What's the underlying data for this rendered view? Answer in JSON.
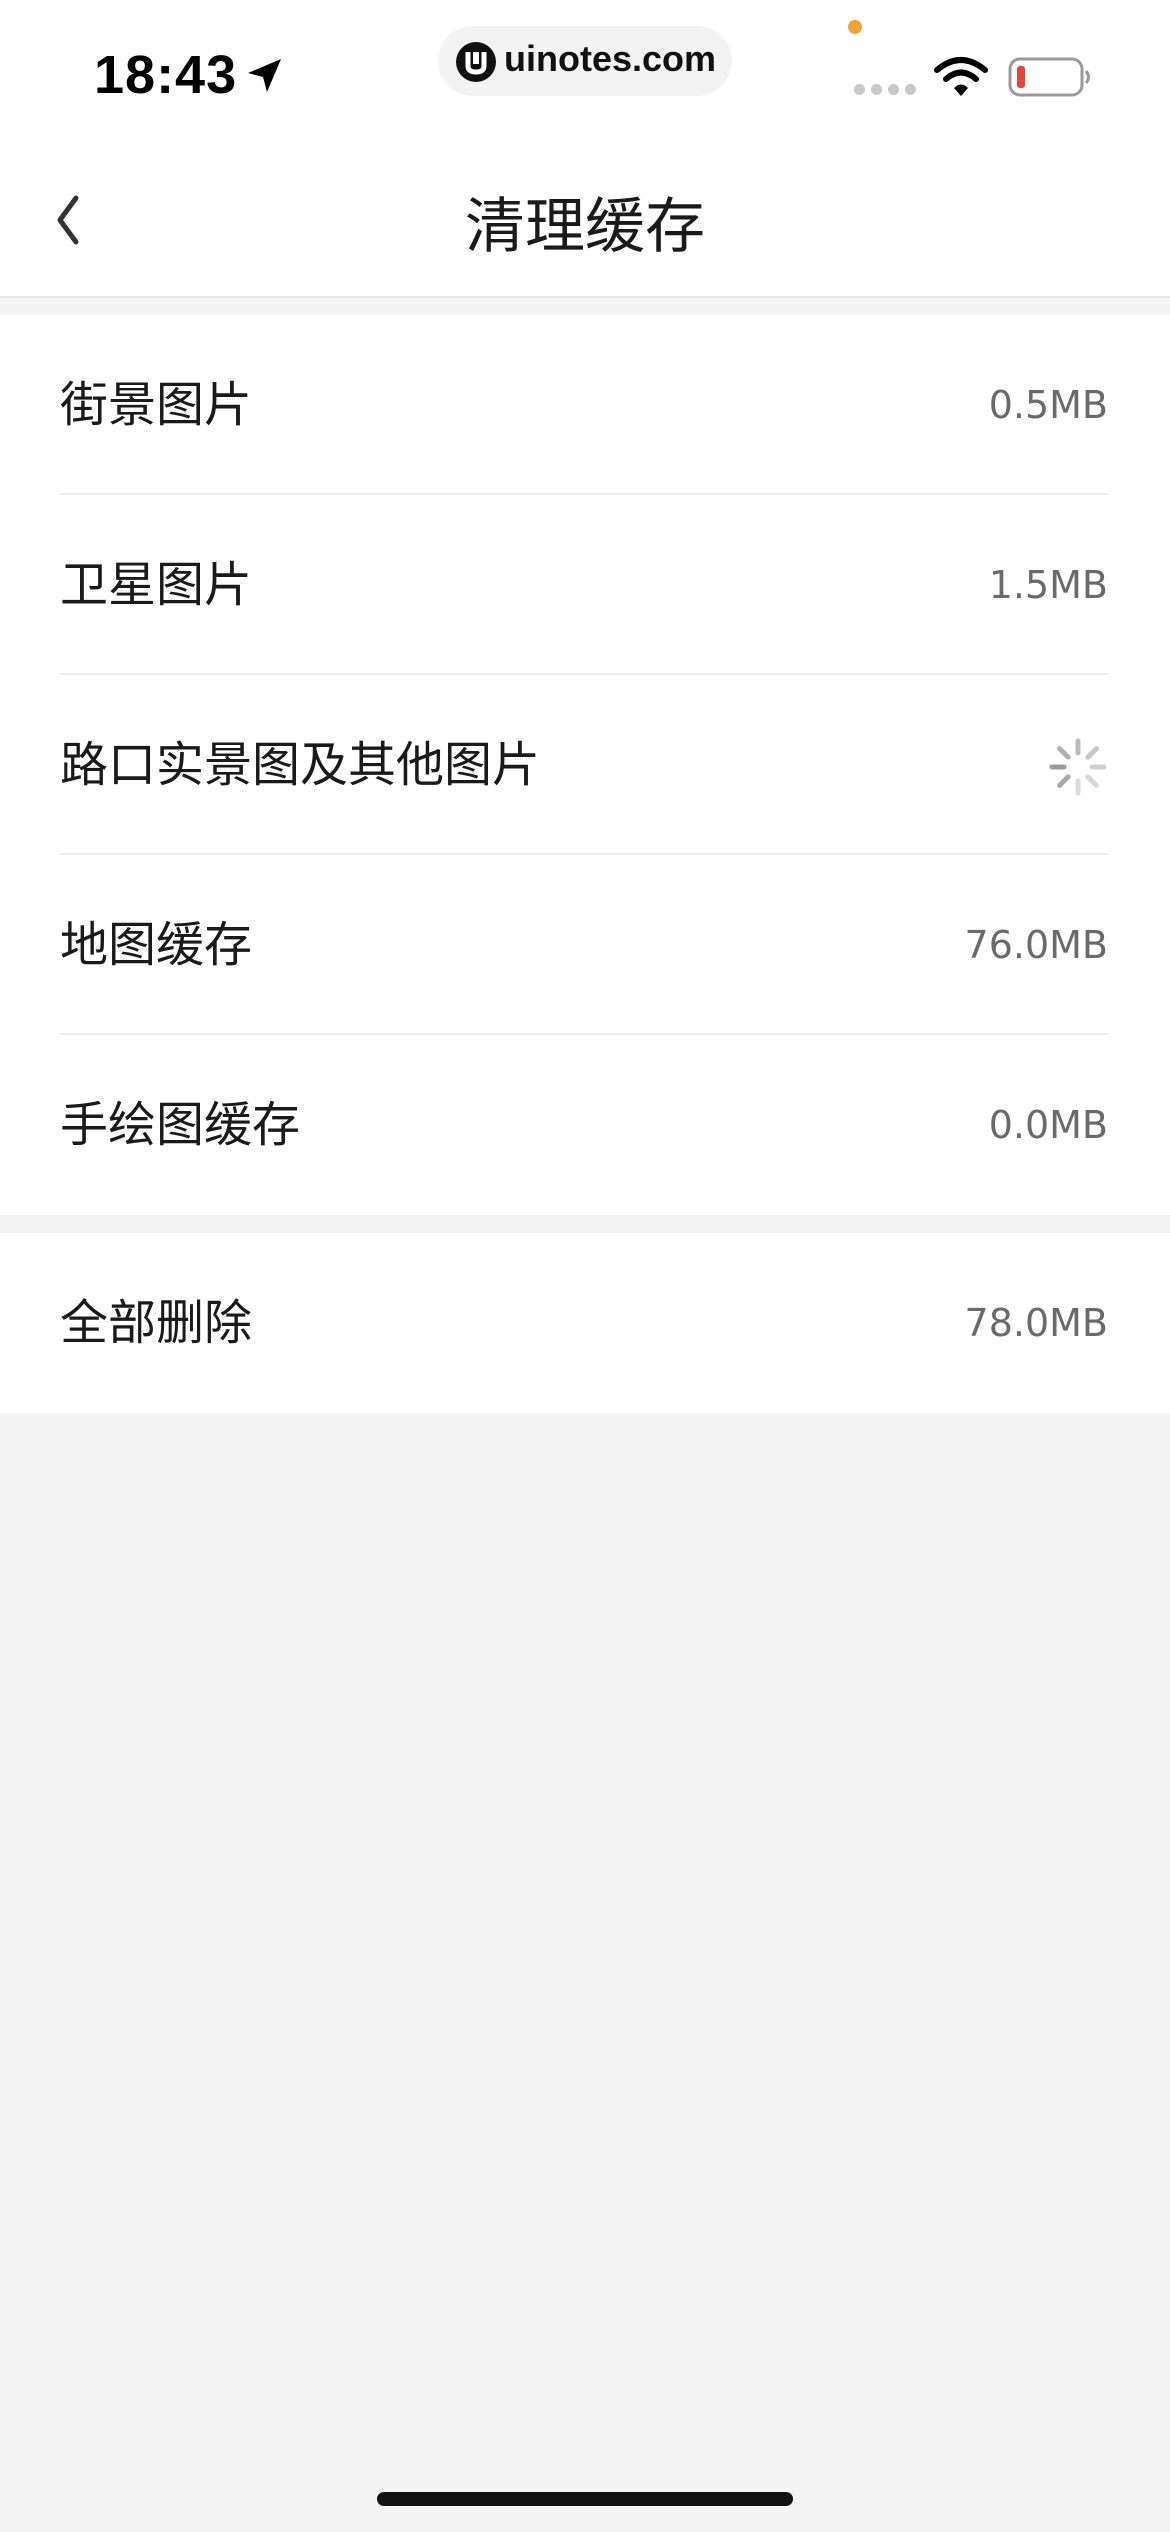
{
  "status_bar": {
    "time": "18:43",
    "watermark": "uinotes.com"
  },
  "nav": {
    "title": "清理缓存",
    "back_icon": "chevron-left-icon"
  },
  "cache_items": [
    {
      "label": "街景图片",
      "value": "0.5MB"
    },
    {
      "label": "卫星图片",
      "value": "1.5MB"
    },
    {
      "label": "路口实景图及其他图片",
      "value": "",
      "loading": true
    },
    {
      "label": "地图缓存",
      "value": "76.0MB"
    },
    {
      "label": "手绘图缓存",
      "value": "0.0MB"
    }
  ],
  "delete_all": {
    "label": "全部删除",
    "value": "78.0MB"
  },
  "colors": {
    "background": "#f4f4f4",
    "card": "#ffffff",
    "value_text": "#6a6a6a",
    "battery_low": "#e5443a"
  }
}
